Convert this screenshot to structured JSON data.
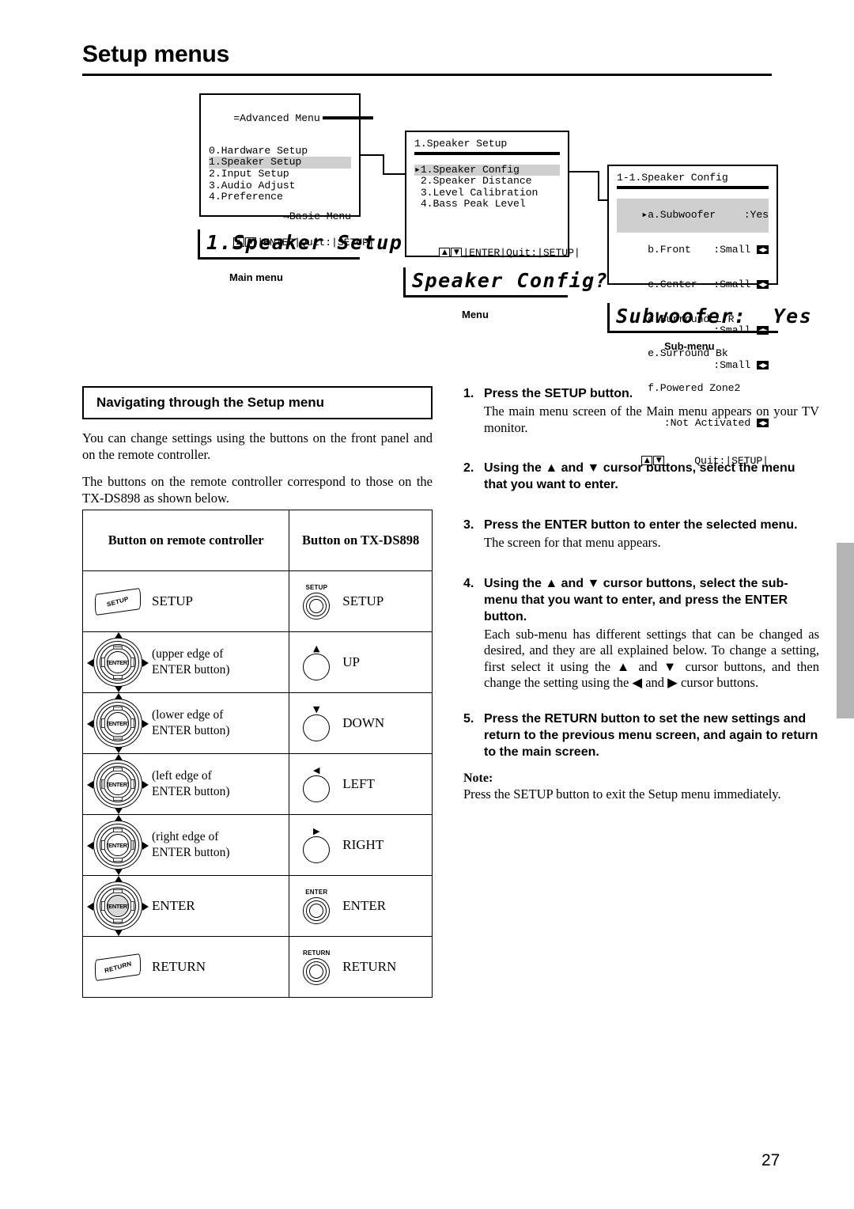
{
  "page": {
    "title": "Setup menus",
    "number": "27"
  },
  "osd": {
    "main_menu": {
      "header": "=Advanced Menu",
      "items": [
        "0.Hardware Setup",
        "1.Speaker Setup",
        "2.Input Setup",
        "3.Audio Adjust",
        "4.Preference"
      ],
      "highlight_index": 1,
      "footer_link": "→Basic Menu",
      "navbar": "|ENTER|Quit:|SETUP|",
      "caption": "Main menu",
      "vfd": "1.Speaker Setup"
    },
    "menu": {
      "header": "1.Speaker Setup",
      "items": [
        "1.Speaker Config",
        "2.Speaker Distance",
        "3.Level Calibration",
        "4.Bass Peak Level"
      ],
      "highlight_index": 0,
      "navbar": "|ENTER|Quit:|SETUP|",
      "caption": "Menu",
      "vfd": "Speaker Config?"
    },
    "sub_menu": {
      "header": "1-1.Speaker Config",
      "rows": [
        {
          "label": "a.Subwoofer",
          "value": ":Yes",
          "lr": false,
          "highlight": true,
          "cursor": true
        },
        {
          "label": "b.Front",
          "value": ":Small",
          "lr": true,
          "highlight": false,
          "cursor": false
        },
        {
          "label": "c.Center",
          "value": ":Small",
          "lr": true,
          "highlight": false,
          "cursor": false
        },
        {
          "label": "d.Surround L/R",
          "value": ":Small",
          "lr": true,
          "highlight": false,
          "cursor": false
        },
        {
          "label": "e.Surround Bk ",
          "value": ":Small",
          "lr": true,
          "highlight": false,
          "cursor": false
        },
        {
          "label": "f.Powered Zone2",
          "value": "",
          "lr": false,
          "highlight": false,
          "cursor": false
        },
        {
          "label": "      ",
          "value": ":Not Activated",
          "lr": true,
          "highlight": false,
          "cursor": false
        }
      ],
      "navbar": "Quit:|SETUP|",
      "caption": "Sub-menu",
      "vfd": "Subwoofer:  Yes"
    },
    "glyphs": {
      "up": "▲",
      "down": "▼",
      "left": "◀",
      "right": "▶",
      "cursor": "▸"
    }
  },
  "left_column": {
    "section_heading": "Navigating through the Setup menu",
    "paragraphs": [
      "You can change settings using the buttons on the front panel and on the remote controller.",
      "The buttons on the remote controller correspond to those on the TX-DS898 as shown below."
    ],
    "table": {
      "headers": [
        "Button on remote controller",
        "Button on TX-DS898"
      ],
      "rows": [
        {
          "remote_icon": "softkey-setup",
          "remote_label": "SETUP",
          "unit_icon": "jog-double",
          "unit_cap": "SETUP",
          "unit_arrow": "",
          "unit_label": "SETUP"
        },
        {
          "remote_icon": "dpad-up",
          "remote_label": "(upper edge of\nENTER button)",
          "unit_icon": "jog-single",
          "unit_cap": "",
          "unit_arrow": "▲",
          "unit_label": "UP"
        },
        {
          "remote_icon": "dpad-down",
          "remote_label": "(lower edge of\nENTER button)",
          "unit_icon": "jog-single",
          "unit_cap": "",
          "unit_arrow": "▼",
          "unit_label": "DOWN"
        },
        {
          "remote_icon": "dpad-left",
          "remote_label": "(left edge of\nENTER button)",
          "unit_icon": "jog-single",
          "unit_cap": "",
          "unit_arrow": "◀",
          "unit_label": "LEFT"
        },
        {
          "remote_icon": "dpad-right",
          "remote_label": "(right edge of\nENTER button)",
          "unit_icon": "jog-single",
          "unit_cap": "",
          "unit_arrow": "▶",
          "unit_label": "RIGHT"
        },
        {
          "remote_icon": "dpad-enter",
          "remote_label": "ENTER",
          "unit_icon": "jog-double",
          "unit_cap": "ENTER",
          "unit_arrow": "",
          "unit_label": "ENTER"
        },
        {
          "remote_icon": "softkey-return",
          "remote_label": "RETURN",
          "unit_icon": "jog-double",
          "unit_cap": "RETURN",
          "unit_arrow": "",
          "unit_label": "RETURN"
        }
      ]
    }
  },
  "right_column": {
    "steps": [
      {
        "num": "1.",
        "title": "Press the SETUP button.",
        "desc": "The main menu screen of the Main menu appears on your TV monitor."
      },
      {
        "num": "2.",
        "title": "Using the ▲ and ▼ cursor buttons, select the menu that you want to enter.",
        "desc": ""
      },
      {
        "num": "3.",
        "title": "Press the ENTER button to enter the selected menu.",
        "desc": "The screen for that menu appears."
      },
      {
        "num": "4.",
        "title": "Using the ▲ and ▼ cursor buttons, select the sub-menu that you want to enter, and press the ENTER button.",
        "desc": "Each sub-menu has different settings that can be changed as desired, and they are all explained below. To change a setting, first select it using the ▲ and ▼ cursor buttons, and then change the setting using the ◀ and ▶ cursor buttons."
      },
      {
        "num": "5.",
        "title": "Press the RETURN button to set the new settings and return to the previous menu screen, and again to return to the main screen.",
        "desc": ""
      }
    ],
    "note_label": "Note:",
    "note_text": "Press the SETUP button to exit the Setup menu immediately."
  }
}
